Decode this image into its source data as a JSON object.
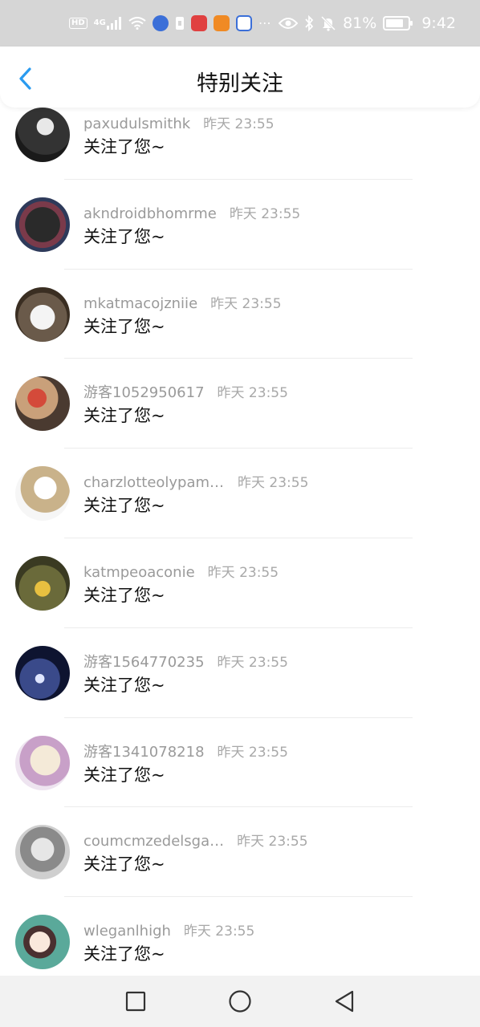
{
  "status_bar": {
    "battery_percent": "81%",
    "battery_level": 0.81,
    "time": "9:42",
    "hd_label": "HD",
    "signal_label": "4G",
    "icons": [
      "hd-icon",
      "signal-icon",
      "wifi-icon",
      "music-app-icon",
      "sim-icon",
      "huawei-app-icon",
      "video-app-icon",
      "baidu-app-icon",
      "more-icon",
      "eye-icon",
      "bluetooth-icon",
      "mute-icon",
      "battery-icon"
    ]
  },
  "header": {
    "title": "特别关注",
    "back_icon": "chevron-left-icon",
    "accent_color": "#2a9bf0"
  },
  "items": [
    {
      "username": "paxudulsmithk",
      "time": "昨天 23:55",
      "message": "关注了您~"
    },
    {
      "username": "akndroidbhomrme",
      "time": "昨天 23:55",
      "message": "关注了您~"
    },
    {
      "username": "mkatmacojzniie",
      "time": "昨天 23:55",
      "message": "关注了您~"
    },
    {
      "username": "游客1052950617",
      "time": "昨天 23:55",
      "message": "关注了您~"
    },
    {
      "username": "charzlotteolypampia",
      "time": "昨天 23:55",
      "message": "关注了您~"
    },
    {
      "username": "katmpeoaconie",
      "time": "昨天 23:55",
      "message": "关注了您~"
    },
    {
      "username": "游客1564770235",
      "time": "昨天 23:55",
      "message": "关注了您~"
    },
    {
      "username": "游客1341078218",
      "time": "昨天 23:55",
      "message": "关注了您~"
    },
    {
      "username": "coumcmzedelsga…",
      "time": "昨天 23:55",
      "message": "关注了您~"
    },
    {
      "username": "wleganlhigh",
      "time": "昨天 23:55",
      "message": "关注了您~"
    }
  ],
  "nav_bar": {
    "icons": [
      "recent-apps-icon",
      "home-icon",
      "back-icon"
    ]
  }
}
